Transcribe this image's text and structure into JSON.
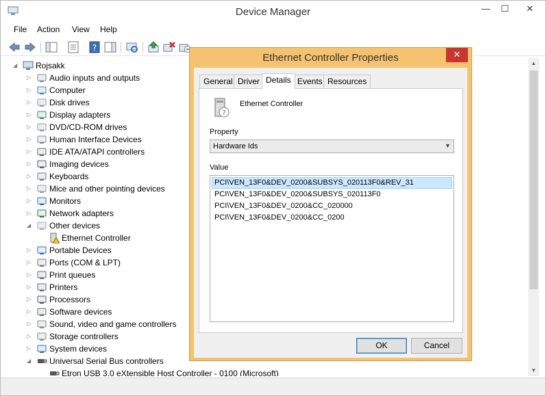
{
  "window": {
    "title": "Device Manager"
  },
  "window_controls": {
    "minimize": "—",
    "maximize": "☐",
    "close": "✕"
  },
  "menu": {
    "file": "File",
    "action": "Action",
    "view": "View",
    "help": "Help"
  },
  "tree": {
    "root": "Rojsakk",
    "items": [
      {
        "label": "Audio inputs and outputs",
        "icon": "speaker-icon"
      },
      {
        "label": "Computer",
        "icon": "computer-icon"
      },
      {
        "label": "Disk drives",
        "icon": "disk-drive-icon"
      },
      {
        "label": "Display adapters",
        "icon": "display-adapter-icon"
      },
      {
        "label": "DVD/CD-ROM drives",
        "icon": "dvd-drive-icon"
      },
      {
        "label": "Human Interface Devices",
        "icon": "hid-icon"
      },
      {
        "label": "IDE ATA/ATAPI controllers",
        "icon": "ide-controller-icon"
      },
      {
        "label": "Imaging devices",
        "icon": "camera-icon"
      },
      {
        "label": "Keyboards",
        "icon": "keyboard-icon"
      },
      {
        "label": "Mice and other pointing devices",
        "icon": "mouse-icon"
      },
      {
        "label": "Monitors",
        "icon": "monitor-icon"
      },
      {
        "label": "Network adapters",
        "icon": "network-adapter-icon"
      },
      {
        "label": "Other devices",
        "icon": "unknown-device-icon"
      },
      {
        "label": "Ethernet Controller",
        "icon": "warning-device-icon"
      },
      {
        "label": "Portable Devices",
        "icon": "portable-device-icon"
      },
      {
        "label": "Ports (COM & LPT)",
        "icon": "port-icon"
      },
      {
        "label": "Print queues",
        "icon": "printer-icon"
      },
      {
        "label": "Printers",
        "icon": "printer-icon"
      },
      {
        "label": "Processors",
        "icon": "processor-icon"
      },
      {
        "label": "Software devices",
        "icon": "software-device-icon"
      },
      {
        "label": "Sound, video and game controllers",
        "icon": "speaker-icon"
      },
      {
        "label": "Storage controllers",
        "icon": "storage-controller-icon"
      },
      {
        "label": "System devices",
        "icon": "system-device-icon"
      },
      {
        "label": "Universal Serial Bus controllers",
        "icon": "usb-icon"
      },
      {
        "label": "Etron USB 3.0 eXtensible Host Controller - 0100 (Microsoft)",
        "icon": "usb-icon"
      }
    ]
  },
  "dialog": {
    "title": "Ethernet Controller Properties",
    "close_glyph": "✕",
    "tabs": [
      "General",
      "Driver",
      "Details",
      "Events",
      "Resources"
    ],
    "active_tab": "Details",
    "device_name": "Ethernet Controller",
    "property_label": "Property",
    "property_value": "Hardware Ids",
    "value_label": "Value",
    "values": [
      "PCI\\VEN_13F0&DEV_0200&SUBSYS_020113F0&REV_31",
      "PCI\\VEN_13F0&DEV_0200&SUBSYS_020113F0",
      "PCI\\VEN_13F0&DEV_0200&CC_020000",
      "PCI\\VEN_13F0&DEV_0200&CC_0200"
    ],
    "ok": "OK",
    "cancel": "Cancel"
  },
  "colors": {
    "dialog_frame": "#f5c36f",
    "close_red": "#c7372f",
    "selection": "#cce8ff"
  }
}
